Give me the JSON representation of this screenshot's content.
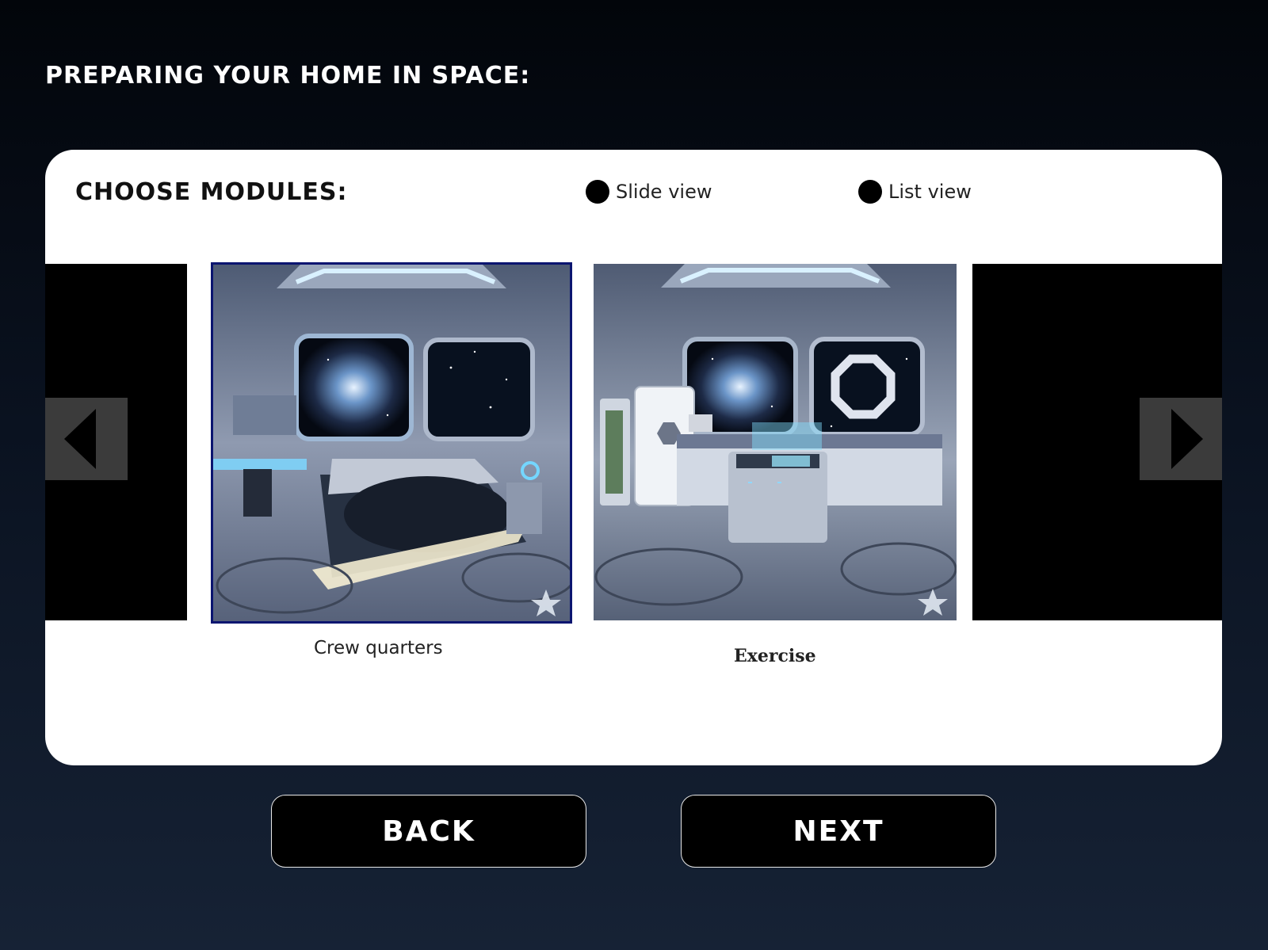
{
  "header": {
    "title": "PREPARING YOUR HOME IN SPACE:"
  },
  "panel": {
    "title": "CHOOSE MODULES:",
    "view_options": [
      {
        "label": "Slide view"
      },
      {
        "label": "List view"
      }
    ]
  },
  "carousel": {
    "prev_icon": "chevron-left-icon",
    "next_icon": "chevron-right-icon",
    "modules": [
      {
        "caption": "Crew quarters",
        "selected": true,
        "image": "bedroom-image"
      },
      {
        "caption": "Exercise",
        "selected": false,
        "image": "kitchen-image"
      }
    ]
  },
  "footer": {
    "back_label": "BACK",
    "next_label": "NEXT"
  },
  "colors": {
    "background_top": "#02050a",
    "background_bottom": "#162235",
    "panel": "#ffffff",
    "selected_border": "#0b1570",
    "button": "#000000",
    "arrow_bg": "#3b3b3b"
  }
}
